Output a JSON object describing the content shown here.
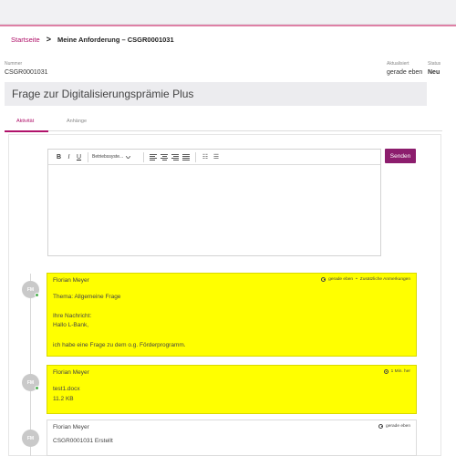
{
  "breadcrumb": {
    "home": "Startseite",
    "separator": ">",
    "current": "Meine Anforderung – CSGR0001031"
  },
  "meta": {
    "number_label": "Nummer",
    "number_value": "CSGR0001031",
    "updated_label": "Aktualisiert",
    "updated_value": "gerade eben",
    "status_label": "Status",
    "status_value": "Neu"
  },
  "title": "Frage zur Digitalisierungsprämie Plus",
  "tabs": [
    {
      "label": "Aktivität",
      "active": true
    },
    {
      "label": "Anhänge",
      "active": false
    }
  ],
  "editor": {
    "toolbar": {
      "bold": "B",
      "italic": "I",
      "underline": "U",
      "font_select": "Betriebssyste...",
      "select_icon": "chevron-down-icon",
      "bullet_list": "☷",
      "numbered_list": "☰"
    },
    "send_label": "Senden"
  },
  "timeline": [
    {
      "avatar": "FM",
      "author": "Florian Meyer",
      "time": "gerade eben",
      "extra": "Zusätzliche Anmerkungen",
      "highlight": true,
      "lines": [
        "Thema: Allgemeine Frage",
        "Ihre Nachricht:",
        "Hallo L-Bank,",
        "ich habe eine Frage zu dem o.g. Förderprogramm."
      ]
    },
    {
      "avatar": "FM",
      "author": "Florian Meyer",
      "time": "1 Min. her",
      "highlight": true,
      "attachment": {
        "name": "test1.docx",
        "size": "11.2 KB"
      }
    },
    {
      "avatar": "FM",
      "author": "Florian Meyer",
      "time": "gerade eben",
      "highlight": false,
      "lines": [
        "CSGR0001031 Erstellt"
      ]
    }
  ],
  "colors": {
    "accent": "#b0126a",
    "send_button": "#8c1d6d",
    "highlight": "#ffff00",
    "online": "#4caf50"
  }
}
